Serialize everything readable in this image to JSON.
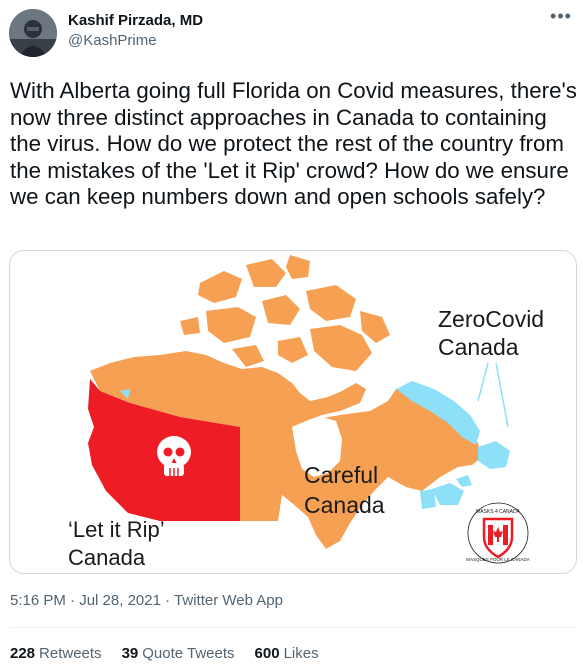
{
  "author": {
    "display_name": "Kashif Pirzada, MD",
    "handle": "@KashPrime"
  },
  "more_icon": "more-horizontal-icon",
  "tweet": {
    "text": "With Alberta going full Florida on Covid measures, there's now three distinct approaches in Canada to containing the virus. How do we protect the rest of the country from the mistakes of the 'Let it Rip' crowd? How do we ensure we can keep numbers down and open schools safely?"
  },
  "map": {
    "label_let_it_rip_1": "‘Let it Rip’",
    "label_let_it_rip_2": "Canada",
    "label_careful_1": "Careful",
    "label_careful_2": "Canada",
    "label_zerocovid_1": "ZeroCovid",
    "label_zerocovid_2": "Canada",
    "logo_text_top": "MASKS 4 CANADA",
    "logo_text_bottom": "MASQUES POUR LE CANADA",
    "colors": {
      "let_it_rip": "#ee1c25",
      "careful": "#f6a054",
      "zerocovid": "#8ee0f8",
      "unassigned": "#ffffff"
    }
  },
  "meta": {
    "time": "5:16 PM",
    "sep1": "·",
    "date": "Jul 28, 2021",
    "sep2": "·",
    "source": "Twitter Web App"
  },
  "stats": {
    "retweets_count": "228",
    "retweets_label": "Retweets",
    "quotes_count": "39",
    "quotes_label": "Quote Tweets",
    "likes_count": "600",
    "likes_label": "Likes"
  }
}
